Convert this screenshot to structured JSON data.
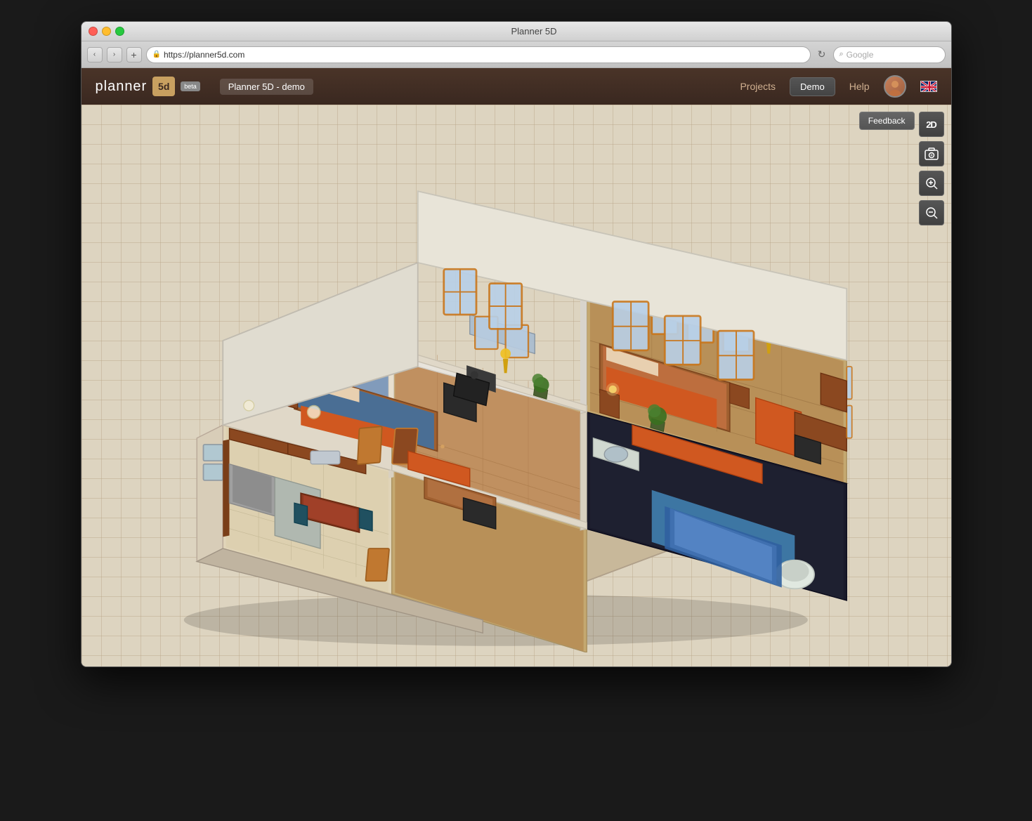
{
  "window": {
    "title": "Planner 5D",
    "titlebar_title": "Planner 5D"
  },
  "browser": {
    "back_label": "‹",
    "forward_label": "›",
    "plus_label": "+",
    "url": "https://planner5d.com",
    "refresh_label": "↻",
    "search_placeholder": "Google"
  },
  "header": {
    "logo_text": "planner",
    "logo_box": "5d",
    "beta": "beta",
    "project_name": "Planner 5D - demo",
    "nav": {
      "projects": "Projects",
      "demo": "Demo",
      "help": "Help"
    }
  },
  "viewport": {
    "feedback_label": "Feedback",
    "view_2d_label": "2D",
    "sidebar_btns": [
      {
        "id": "screenshot",
        "icon": "📷",
        "label": "screenshot"
      },
      {
        "id": "zoom-in",
        "icon": "🔍+",
        "label": "zoom-in"
      },
      {
        "id": "zoom-out",
        "icon": "🔍-",
        "label": "zoom-out"
      }
    ]
  },
  "icons": {
    "lock": "🔒",
    "camera": "⊙",
    "zoom_in": "+",
    "zoom_out": "−",
    "search": "⌕"
  }
}
